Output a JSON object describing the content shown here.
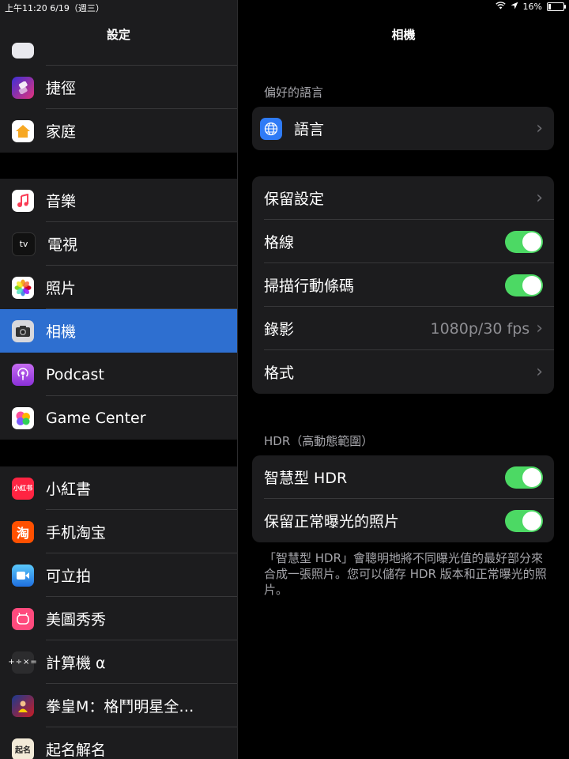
{
  "status_bar": {
    "time_date": "上午11:20   6/19（週三）",
    "battery": "16%"
  },
  "sidebar": {
    "title": "設定",
    "group1": [
      {
        "label": "捷徑",
        "icon": "shortcuts-icon"
      },
      {
        "label": "家庭",
        "icon": "home-icon"
      }
    ],
    "group2": [
      {
        "label": "音樂",
        "icon": "music-icon"
      },
      {
        "label": "電視",
        "icon": "tv-icon",
        "glyph": "tv"
      },
      {
        "label": "照片",
        "icon": "photos-icon"
      },
      {
        "label": "相機",
        "icon": "camera-icon"
      },
      {
        "label": "Podcast",
        "icon": "podcast-icon"
      },
      {
        "label": "Game Center",
        "icon": "game-center-icon"
      }
    ],
    "group3": [
      {
        "label": "小紅書",
        "icon": "xiaohongshu-icon",
        "glyph": "小红书"
      },
      {
        "label": "手机淘宝",
        "icon": "taobao-icon",
        "glyph": "淘"
      },
      {
        "label": "可立拍",
        "icon": "clips-icon"
      },
      {
        "label": "美圖秀秀",
        "icon": "meitu-icon"
      },
      {
        "label": "計算機 α",
        "icon": "calculator-icon",
        "glyph": "+÷×="
      },
      {
        "label": "拳皇M：格鬥明星全…",
        "icon": "kof-icon"
      },
      {
        "label": "起名解名",
        "icon": "naming-icon",
        "glyph": "起名"
      }
    ]
  },
  "detail": {
    "title": "相機",
    "preferred_language_header": "偏好的語言",
    "language": {
      "label": "語言"
    },
    "settings": [
      {
        "label": "保留設定"
      },
      {
        "label": "格線",
        "toggle": true
      },
      {
        "label": "掃描行動條碼",
        "toggle": true
      },
      {
        "label": "錄影",
        "value": "1080p/30 fps"
      },
      {
        "label": "格式"
      }
    ],
    "hdr_header": "HDR（高動態範圍）",
    "hdr": [
      {
        "label": "智慧型 HDR",
        "toggle": true
      },
      {
        "label": "保留正常曝光的照片",
        "toggle": true
      }
    ],
    "footnote": "「智慧型 HDR」會聰明地將不同曝光值的最好部分來合成一張照片。您可以儲存 HDR 版本和正常曝光的照片。"
  },
  "colors": {
    "accent": "#2e6fd0",
    "toggle_on": "#4cd964",
    "group_bg": "#1c1c1e"
  }
}
